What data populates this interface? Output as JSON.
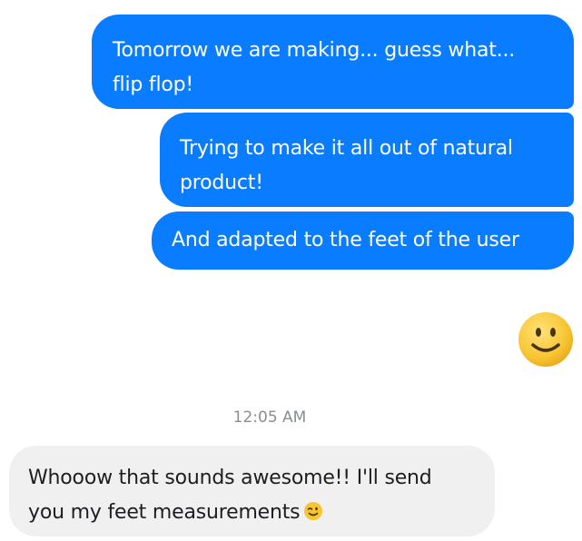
{
  "conversation": {
    "messages": [
      {
        "sender": "me",
        "lines": [
          "Tomorrow we are making... guess what...",
          "flip flop!"
        ]
      },
      {
        "sender": "me",
        "lines": [
          "Trying to make it all out of natural",
          "product!"
        ]
      },
      {
        "sender": "me",
        "lines": [
          "And adapted to the feet of the user"
        ]
      },
      {
        "sender": "me",
        "emoji": "smiling-face-icon"
      },
      {
        "sender": "other",
        "lines": [
          "Whooow that sounds awesome!! I'll send",
          "you my feet measurements"
        ],
        "inline_emoji": "winking-face-icon"
      }
    ],
    "timestamp": "12:05 AM"
  },
  "colors": {
    "outgoing_bubble": "#0a7cff",
    "incoming_bubble": "#f1f0f0",
    "emoji_yellow": "#f5c33b",
    "timestamp_text": "#8a8d91"
  }
}
